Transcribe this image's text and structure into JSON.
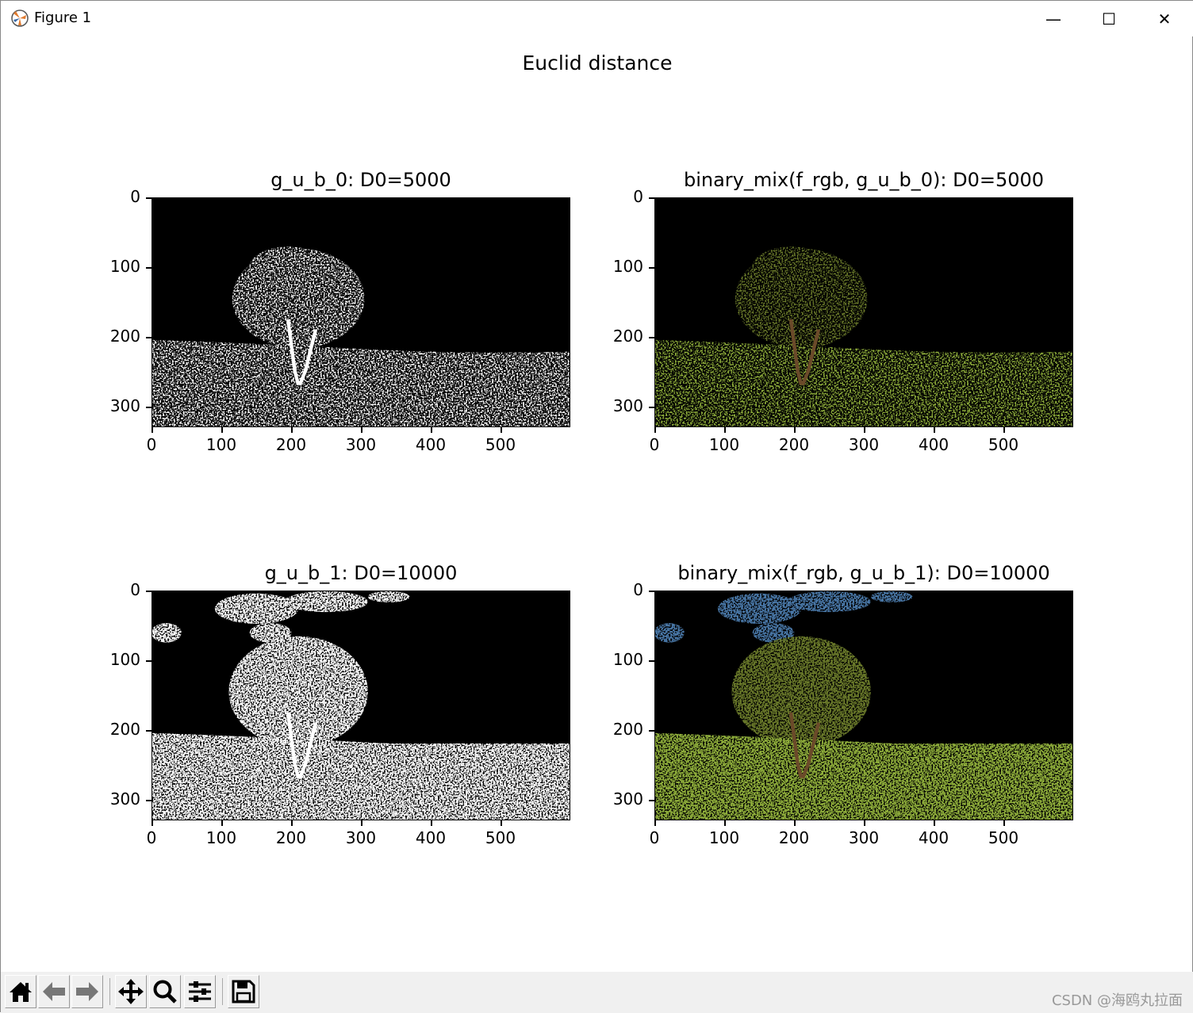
{
  "window": {
    "title": "Figure 1",
    "minimize": "—",
    "maximize": "☐",
    "close": "✕"
  },
  "figure": {
    "suptitle": "Euclid distance"
  },
  "chart_data": [
    {
      "type": "image",
      "title": "g_u_b_0: D0=5000",
      "variant": "binary",
      "density": 1,
      "xticks": [
        0,
        100,
        200,
        300,
        400,
        500
      ],
      "yticks": [
        0,
        100,
        200,
        300
      ],
      "xlim": [
        0,
        600
      ],
      "ylim": [
        329,
        0
      ]
    },
    {
      "type": "image",
      "title": "binary_mix(f_rgb, g_u_b_0): D0=5000",
      "variant": "mix",
      "density": 1,
      "xticks": [
        0,
        100,
        200,
        300,
        400,
        500
      ],
      "yticks": [
        0,
        100,
        200,
        300
      ],
      "xlim": [
        0,
        600
      ],
      "ylim": [
        329,
        0
      ]
    },
    {
      "type": "image",
      "title": "g_u_b_1: D0=10000",
      "variant": "binary",
      "density": 2,
      "xticks": [
        0,
        100,
        200,
        300,
        400,
        500
      ],
      "yticks": [
        0,
        100,
        200,
        300
      ],
      "xlim": [
        0,
        600
      ],
      "ylim": [
        329,
        0
      ]
    },
    {
      "type": "image",
      "title": "binary_mix(f_rgb, g_u_b_1): D0=10000",
      "variant": "mix",
      "density": 2,
      "xticks": [
        0,
        100,
        200,
        300,
        400,
        500
      ],
      "yticks": [
        0,
        100,
        200,
        300
      ],
      "xlim": [
        0,
        600
      ],
      "ylim": [
        329,
        0
      ]
    }
  ],
  "toolbar": {
    "buttons": [
      "home",
      "back",
      "forward",
      "pan",
      "zoom",
      "configure-subplots",
      "save"
    ]
  },
  "watermark": "CSDN @海鸥丸拉面",
  "colors": {
    "tree": "#6b7a2a",
    "grass": "#8fae3a",
    "sky": "#4a78a8",
    "white": "#ffffff"
  }
}
